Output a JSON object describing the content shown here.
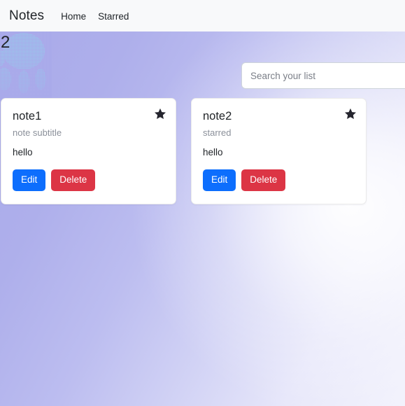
{
  "navbar": {
    "brand": "Notes",
    "links": [
      {
        "label": "Home",
        "name": "nav-link-home"
      },
      {
        "label": "Starred",
        "name": "nav-link-starred"
      }
    ]
  },
  "broken_image": {
    "alt_text": "2"
  },
  "search": {
    "value": "",
    "placeholder": "Search your list"
  },
  "buttons": {
    "edit_label": "Edit",
    "delete_label": "Delete"
  },
  "icons": {
    "star": "star-icon"
  },
  "colors": {
    "navbar_bg": "#f8f9fa",
    "edit_button": "#0d6efd",
    "delete_button": "#dc3545",
    "card_bg": "#ffffff",
    "star": "#25252e",
    "subtitle_text": "#8b909a",
    "body_text": "#212529",
    "background_purple": "#a9aaea"
  },
  "notes": [
    {
      "title": "note1",
      "subtitle": "note subtitle",
      "body": "hello",
      "starred": true
    },
    {
      "title": "note2",
      "subtitle": "starred",
      "body": "hello",
      "starred": true
    }
  ]
}
